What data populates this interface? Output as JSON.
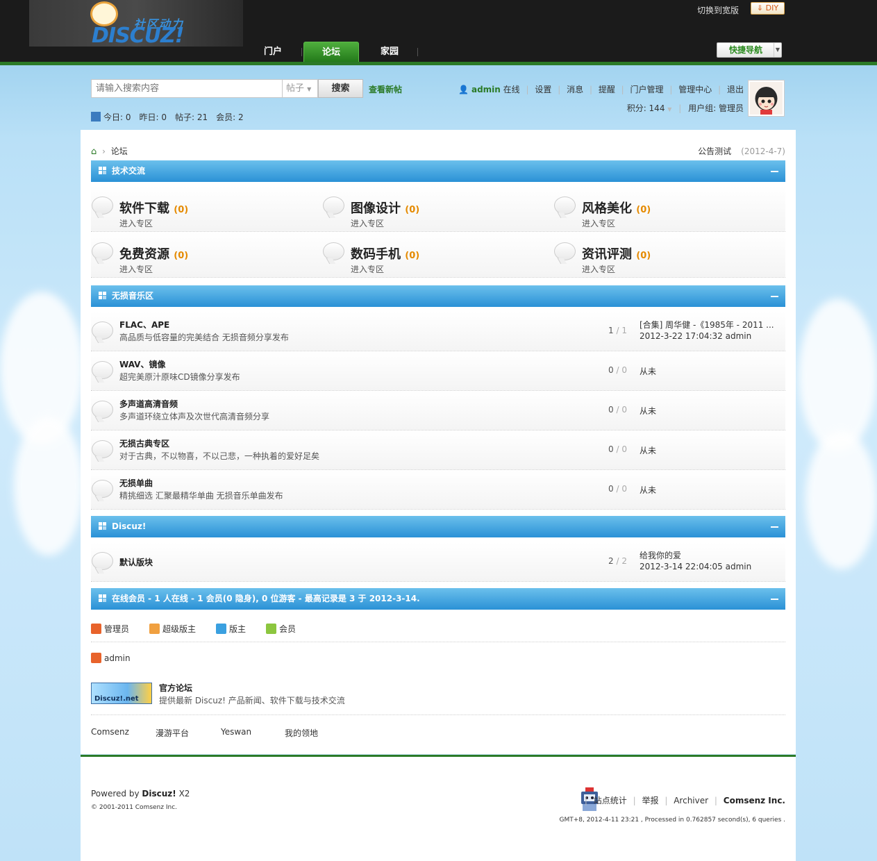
{
  "top": {
    "logo_cn": "社区动力",
    "logo_en": "DISCUZ!",
    "switch_wide": "切换到宽版",
    "diy": "DIY",
    "quick_nav": "快捷导航",
    "nav": [
      "门户",
      "论坛",
      "家园"
    ]
  },
  "search": {
    "placeholder": "请输入搜索内容",
    "type": "帖子",
    "button": "搜索",
    "new_posts": "查看新帖"
  },
  "stats": {
    "today": "今日: 0",
    "yesterday": "昨日: 0",
    "posts": "帖子: 21",
    "members": "会员: 2"
  },
  "user": {
    "name": "admin",
    "status": "在线",
    "links": [
      "设置",
      "消息",
      "提醒",
      "门户管理",
      "管理中心",
      "退出"
    ],
    "points": "积分: 144",
    "group": "用户组: 管理员"
  },
  "breadcrumb": {
    "label": "论坛"
  },
  "announcement": {
    "title": "公告测试",
    "date": "(2012-4-7)"
  },
  "categories": [
    {
      "title": "技术交流",
      "forums": [
        {
          "name": "软件下载",
          "count": "(0)",
          "enter": "进入专区"
        },
        {
          "name": "图像设计",
          "count": "(0)",
          "enter": "进入专区"
        },
        {
          "name": "风格美化",
          "count": "(0)",
          "enter": "进入专区"
        },
        {
          "name": "免费资源",
          "count": "(0)",
          "enter": "进入专区"
        },
        {
          "name": "数码手机",
          "count": "(0)",
          "enter": "进入专区"
        },
        {
          "name": "资讯评测",
          "count": "(0)",
          "enter": "进入专区"
        }
      ]
    },
    {
      "title": "无损音乐区",
      "forums": [
        {
          "name": "FLAC、APE",
          "desc": "高品质与低容量的完美结合 无损音频分享发布",
          "threads": "1",
          "posts": "1",
          "last_title": "[合集] 周华健 -《1985年 - 2011 ...",
          "last_info": "2012-3-22 17:04:32 admin"
        },
        {
          "name": "WAV、镜像",
          "desc": "超完美原汁原味CD镜像分享发布",
          "threads": "0",
          "posts": "0",
          "last_title": "从未"
        },
        {
          "name": "多声道高清音频",
          "desc": "多声道环绕立体声及次世代高清音频分享",
          "threads": "0",
          "posts": "0",
          "last_title": "从未"
        },
        {
          "name": "无损古典专区",
          "desc": "对于古典，不以物喜，不以己悲，一种执着的爱好足矣",
          "threads": "0",
          "posts": "0",
          "last_title": "从未"
        },
        {
          "name": "无损单曲",
          "desc": "精挑细选 汇聚最精华单曲 无损音乐单曲发布",
          "threads": "0",
          "posts": "0",
          "last_title": "从未"
        }
      ]
    },
    {
      "title": "Discuz!",
      "forums": [
        {
          "name": "默认版块",
          "threads": "2",
          "posts": "2",
          "last_title": "给我你的爱",
          "last_info": "2012-3-14 22:04:05 admin"
        }
      ]
    }
  ],
  "online": {
    "title": "在线会员 - 1 人在线 - 1 会员(0 隐身), 0 位游客 - 最高记录是 3 于 2012-3-14.",
    "legend": [
      "管理员",
      "超级版主",
      "版主",
      "会员"
    ],
    "users": [
      "admin"
    ],
    "colors": {
      "admin": "#e8632b",
      "super": "#f0a040",
      "mod": "#3aa0e0",
      "member": "#8cc63f"
    }
  },
  "links": {
    "logo_text": "Discuz!.net",
    "official_title": "官方论坛",
    "official_desc": "提供最新 Discuz! 产品新闻、软件下载与技术交流",
    "text_links": [
      "Comsenz",
      "漫游平台",
      "Yeswan",
      "我的领地"
    ]
  },
  "footer": {
    "powered_prefix": "Powered by",
    "product": "Discuz!",
    "version": "X2",
    "copyright": "© 2001-2011 Comsenz Inc.",
    "links": [
      "站点统计",
      "举报",
      "Archiver"
    ],
    "company": "Comsenz Inc.",
    "gmt": "GMT+8, 2012-4-11 23:21 , Processed in 0.762857 second(s), 6 queries ."
  }
}
